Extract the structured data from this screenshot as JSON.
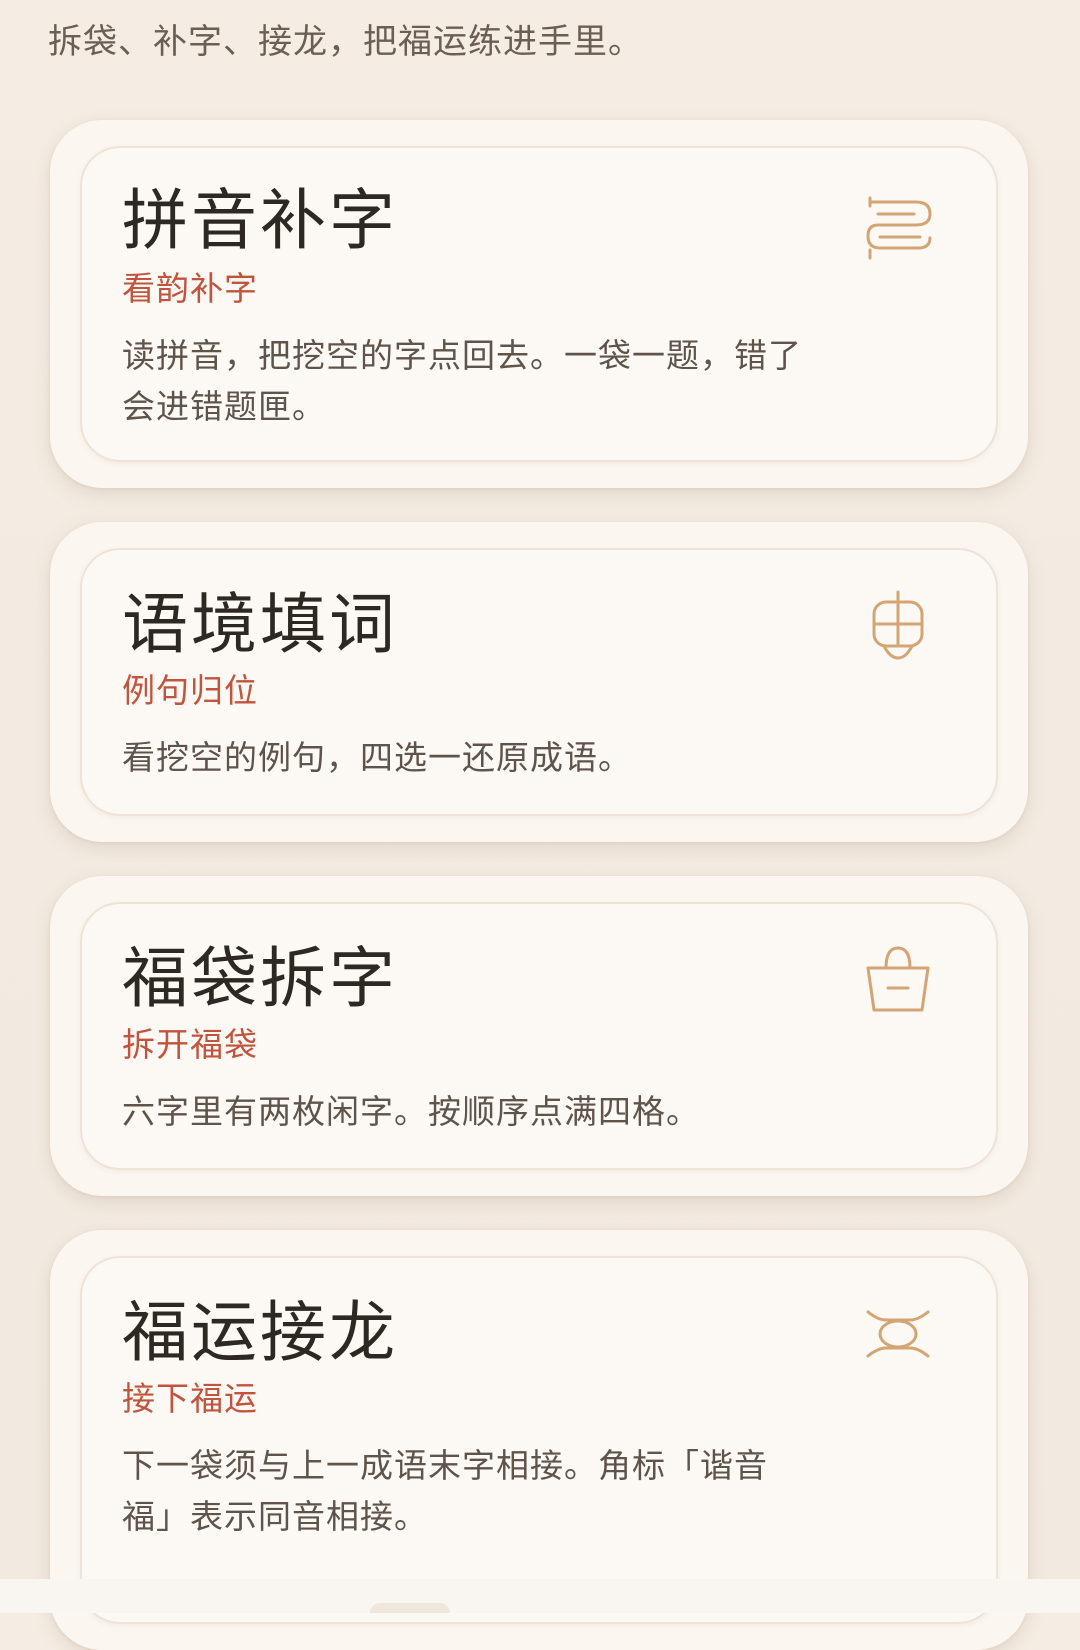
{
  "intro_text": "拆袋、补字、接龙，把福运练进手里。",
  "accent_color": "#c2543e",
  "icon_color": "#d4a574",
  "cards": [
    {
      "title": "拼音补字",
      "subtitle": "看韵补字",
      "description": "读拼音，把挖空的字点回去。一袋一题，错了会进错题匣。",
      "icon": "scroll-icon"
    },
    {
      "title": "语境填词",
      "subtitle": "例句归位",
      "description": "看挖空的例句，四选一还原成语。",
      "icon": "lantern-icon"
    },
    {
      "title": "福袋拆字",
      "subtitle": "拆开福袋",
      "description": "六字里有两枚闲字。按顺序点满四格。",
      "icon": "bag-icon"
    },
    {
      "title": "福运接龙",
      "subtitle": "接下福运",
      "description": "下一袋须与上一成语末字相接。角标「谐音福」表示同音相接。",
      "icon": "knot-icon"
    }
  ]
}
